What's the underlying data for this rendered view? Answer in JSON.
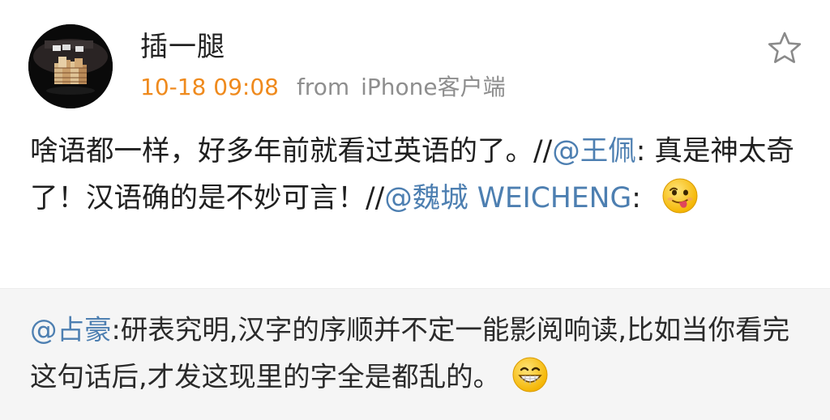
{
  "post": {
    "username": "插一腿",
    "time": "10-18 09:08",
    "from_label": "from",
    "source": "iPhone客户端",
    "text_1": "啥语都一样，好多年前就看过英语的了。//",
    "mention_1": "@王佩",
    "text_2": ": 真是神太奇了！汉语确的是不妙可言！//",
    "mention_2": "@魏城 WEICHENG",
    "text_3": ": ",
    "emoji_1": "tongue-out-emoji"
  },
  "retweet": {
    "mention": "@占豪",
    "text": ":研表究明,汉字的序顺并不定一能影阅响读,比如当你看完这句话后,才发这现里的字全是都乱的。",
    "emoji": "grin-emoji"
  },
  "icons": {
    "favorite": "star-outline-icon",
    "avatar": "poker-chips-avatar"
  },
  "colors": {
    "time": "#ef8a1d",
    "meta": "#8e8e8e",
    "mention": "#4d7fb1",
    "text": "#1f1f1f",
    "retweet_bg": "#f5f5f5"
  }
}
